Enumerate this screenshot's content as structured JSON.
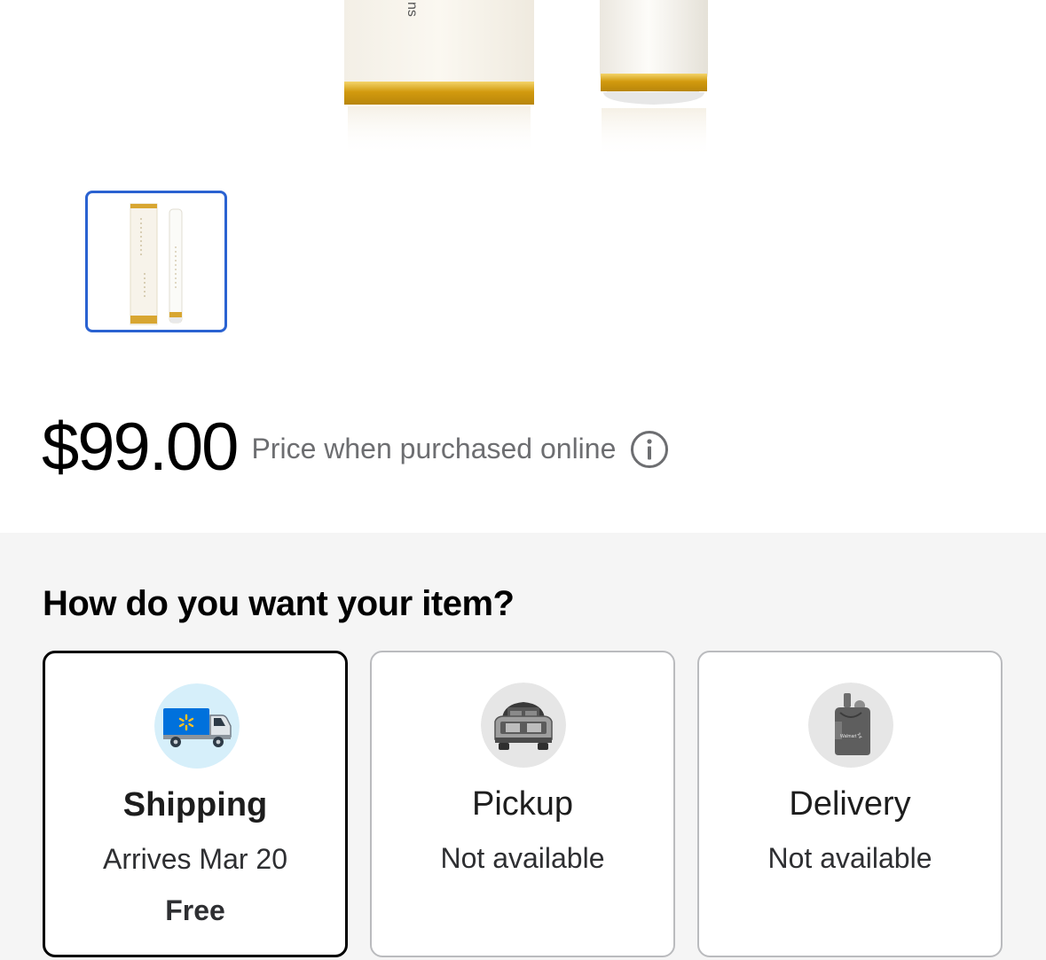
{
  "product": {
    "box_side_text": "ns",
    "price": "$99.00",
    "price_note": "Price when purchased online",
    "info_icon": "info-icon",
    "thumbnail_icon": "product-thumbnail"
  },
  "fulfillment": {
    "title": "How do you want your item?",
    "options": [
      {
        "label": "Shipping",
        "sub": "Arrives Mar 20",
        "extra": "Free",
        "icon": "shipping-truck-icon",
        "selected": true
      },
      {
        "label": "Pickup",
        "sub": "Not available",
        "icon": "pickup-car-icon",
        "selected": false
      },
      {
        "label": "Delivery",
        "sub": "Not available",
        "icon": "delivery-bag-icon",
        "selected": false
      }
    ]
  },
  "colors": {
    "thumbnail_border": "#2a62d1",
    "section_background": "#f5f5f5",
    "selected_border": "#000000",
    "card_border": "#babbbe",
    "muted_text": "#6d6e71",
    "shipping_icon_bg": "#d6effa",
    "walmart_blue": "#0071dc",
    "walmart_spark": "#ffc220"
  }
}
